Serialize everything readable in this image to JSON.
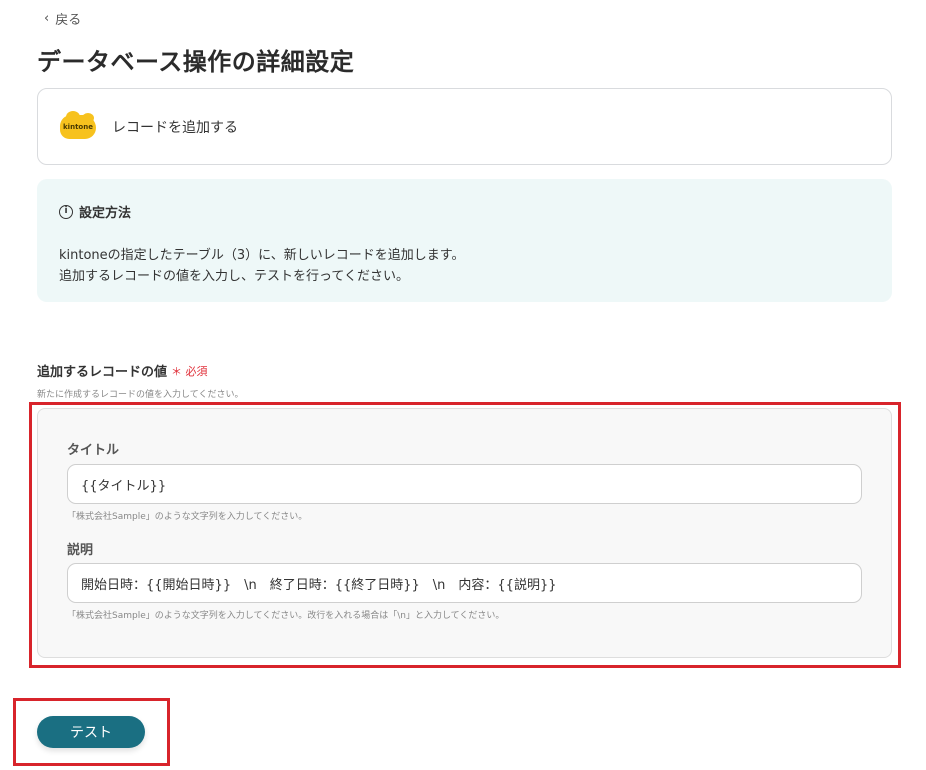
{
  "nav": {
    "back_label": "戻る"
  },
  "page": {
    "title": "データベース操作の詳細設定"
  },
  "action": {
    "app_logo_text": "kintone",
    "label": "レコードを追加する"
  },
  "info": {
    "heading": "設定方法",
    "line1": "kintoneの指定したテーブル（3）に、新しいレコードを追加します。",
    "line2": "追加するレコードの値を入力し、テストを行ってください。"
  },
  "record_values": {
    "heading": "追加するレコードの値",
    "required_label": "＊ 必須",
    "description": "新たに作成するレコードの値を入力してください。",
    "fields": [
      {
        "label": "タイトル",
        "value": "{{タイトル}}",
        "hint": "「株式会社Sample」のような文字列を入力してください。"
      },
      {
        "label": "説明",
        "value": "開始日時：{{開始日時}}　\\n　終了日時：{{終了日時}}　\\n　内容：{{説明}}",
        "hint": "「株式会社Sample」のような文字列を入力してください。改行を入れる場合は「\\n」と入力してください。"
      }
    ]
  },
  "actions": {
    "test_label": "テスト"
  },
  "colors": {
    "primary": "#1a6f82",
    "highlight": "#d8242b",
    "info_bg": "#eef8f8",
    "required": "#e0303a",
    "kintone_yellow": "#f7c21e"
  }
}
